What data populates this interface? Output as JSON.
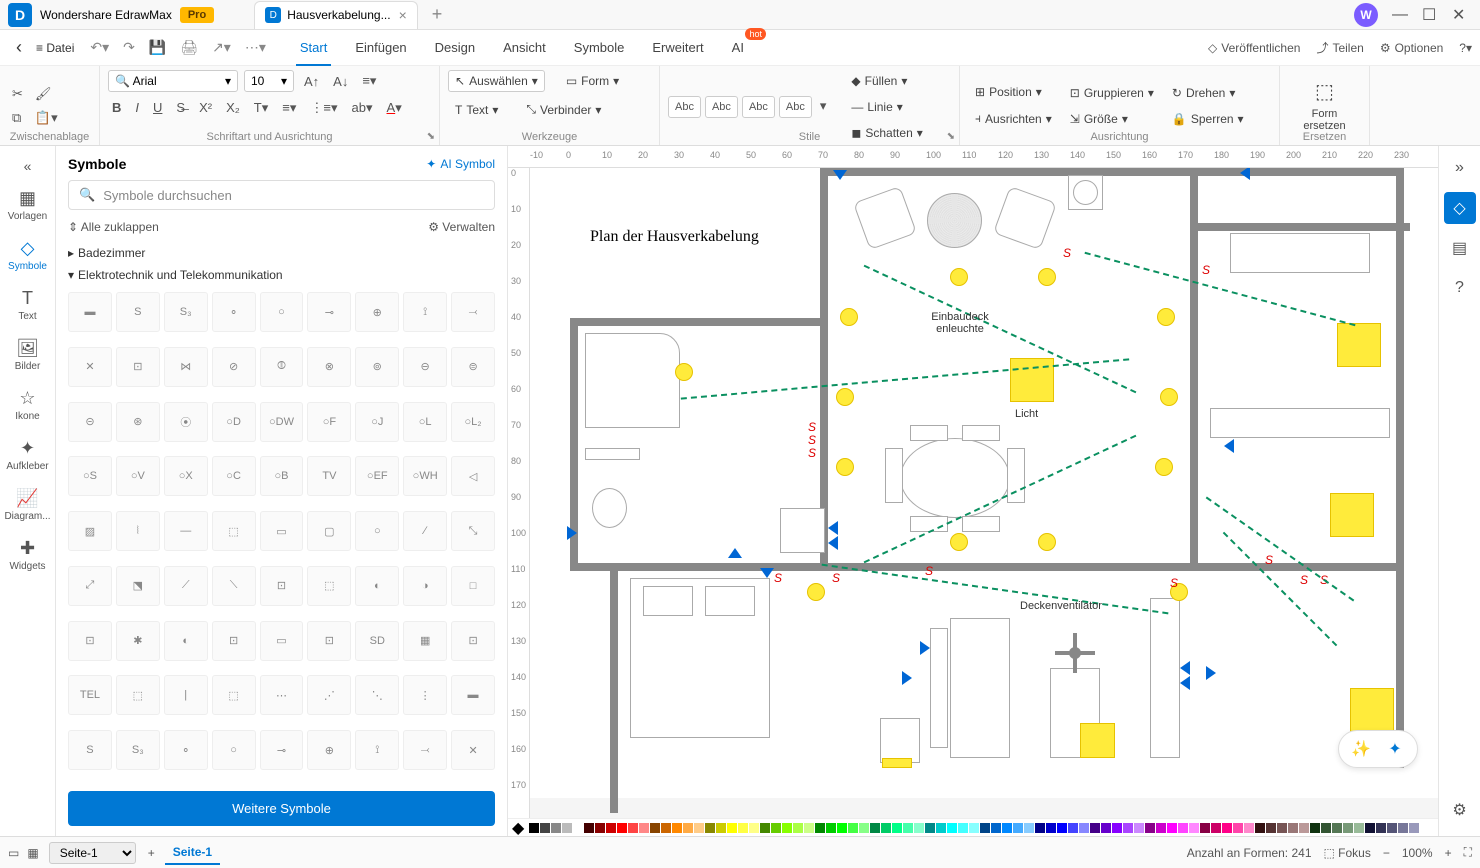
{
  "titlebar": {
    "app_name": "Wondershare EdrawMax",
    "pro": "Pro",
    "tab_title": "Hausverkabelung...",
    "avatar_letter": "W"
  },
  "menu": {
    "datei": "Datei",
    "tabs": [
      "Start",
      "Einfügen",
      "Design",
      "Ansicht",
      "Symbole",
      "Erweitert",
      "AI"
    ],
    "hot": "hot",
    "publish": "Veröffentlichen",
    "share": "Teilen",
    "options": "Optionen"
  },
  "ribbon": {
    "clipboard_label": "Zwischenablage",
    "font_label": "Schriftart und Ausrichtung",
    "tools_label": "Werkzeuge",
    "styles_label": "Stile",
    "align_label": "Ausrichtung",
    "replace_label": "Ersetzen",
    "font_name": "Arial",
    "font_size": "10",
    "select": "Auswählen",
    "text": "Text",
    "form": "Form",
    "connector": "Verbinder",
    "abc": "Abc",
    "fill": "Füllen",
    "line": "Linie",
    "shadow": "Schatten",
    "position": "Position",
    "align": "Ausrichten",
    "group": "Gruppieren",
    "size": "Größe",
    "rotate": "Drehen",
    "lock": "Sperren",
    "replace_shape": "Form ersetzen"
  },
  "sidebar": {
    "items": [
      {
        "label": "Vorlagen"
      },
      {
        "label": "Symbole"
      },
      {
        "label": "Text"
      },
      {
        "label": "Bilder"
      },
      {
        "label": "Ikone"
      },
      {
        "label": "Aufkleber"
      },
      {
        "label": "Diagram..."
      },
      {
        "label": "Widgets"
      }
    ]
  },
  "panel": {
    "title": "Symbole",
    "ai_symbol": "AI Symbol",
    "search_placeholder": "Symbole durchsuchen",
    "collapse_all": "Alle zuklappen",
    "manage": "Verwalten",
    "cat_bathroom": "Badezimmer",
    "cat_electro": "Elektrotechnik und Telekommunikation",
    "more": "Weitere Symbole"
  },
  "canvas": {
    "title": "Plan der Hausverkabelung",
    "labels": {
      "recessed": "Einbaudeck enleuchte",
      "light": "Licht",
      "fan": "Deckenventilator"
    }
  },
  "status": {
    "page_select": "Seite-1",
    "page_tab": "Seite-1",
    "shape_count": "Anzahl an Formen: 241",
    "focus": "Fokus",
    "zoom": "100%"
  },
  "ruler_h": [
    "-10",
    "0",
    "10",
    "20",
    "30",
    "40",
    "50",
    "60",
    "70",
    "80",
    "90",
    "100",
    "110",
    "120",
    "130",
    "140",
    "150",
    "160",
    "170",
    "180",
    "190",
    "200",
    "210",
    "220",
    "230"
  ],
  "ruler_v": [
    "0",
    "10",
    "20",
    "30",
    "40",
    "50",
    "60",
    "70",
    "80",
    "90",
    "100",
    "110",
    "120",
    "130",
    "140",
    "150",
    "160",
    "170"
  ]
}
